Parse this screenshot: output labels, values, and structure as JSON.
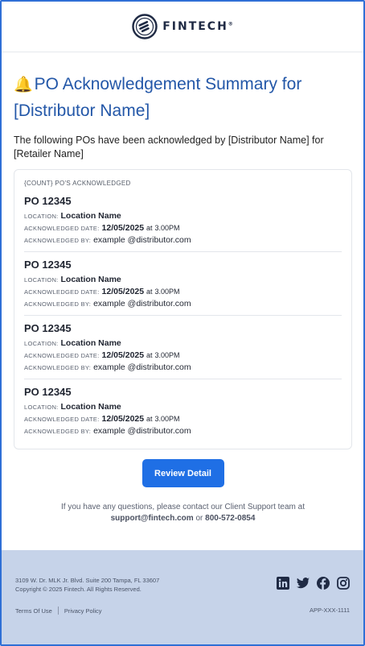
{
  "brand": {
    "name": "FINTECH",
    "mark": "®"
  },
  "title": "PO Acknowledgement Summary for [Distributor Name]",
  "bell_icon": "🔔",
  "intro": "The following POs have been acknowledged by [Distributor Name] for [Retailer Name]",
  "count_label": "{COUNT} PO'S ACKNOWLEDGED",
  "labels": {
    "location": "LOCATION:",
    "ack_date": "ACKNOWLEDGED DATE:",
    "ack_by": "ACKNOWLEDGED BY:",
    "at": "at"
  },
  "pos": [
    {
      "title": "PO 12345",
      "location": "Location Name",
      "date": "12/05/2025",
      "time": "3.00PM",
      "by": "example @distributor.com"
    },
    {
      "title": "PO 12345",
      "location": "Location Name",
      "date": "12/05/2025",
      "time": "3.00PM",
      "by": "example @distributor.com"
    },
    {
      "title": "PO 12345",
      "location": "Location Name",
      "date": "12/05/2025",
      "time": "3.00PM",
      "by": "example @distributor.com"
    },
    {
      "title": "PO 12345",
      "location": "Location Name",
      "date": "12/05/2025",
      "time": "3.00PM",
      "by": "example @distributor.com"
    }
  ],
  "cta_label": "Review Detail",
  "support": {
    "text": "If you have any questions, please contact our Client Support team at",
    "email": "support@fintech.com",
    "or": "or",
    "phone": "800-572-0854"
  },
  "footer": {
    "address": "3109 W. Dr. MLK Jr. Blvd. Suite 200 Tampa, FL 33607",
    "copyright": "Copyright © 2025 Fintech. All Rights Reserved.",
    "terms": "Terms Of Use",
    "privacy": "Privacy Policy",
    "app_id": "APP-XXX-1111",
    "social": [
      "linkedin-icon",
      "twitter-icon",
      "facebook-icon",
      "instagram-icon"
    ]
  },
  "colors": {
    "accent": "#1f6fe5",
    "title": "#2357a8",
    "footer_bg": "#c6d3e9"
  }
}
